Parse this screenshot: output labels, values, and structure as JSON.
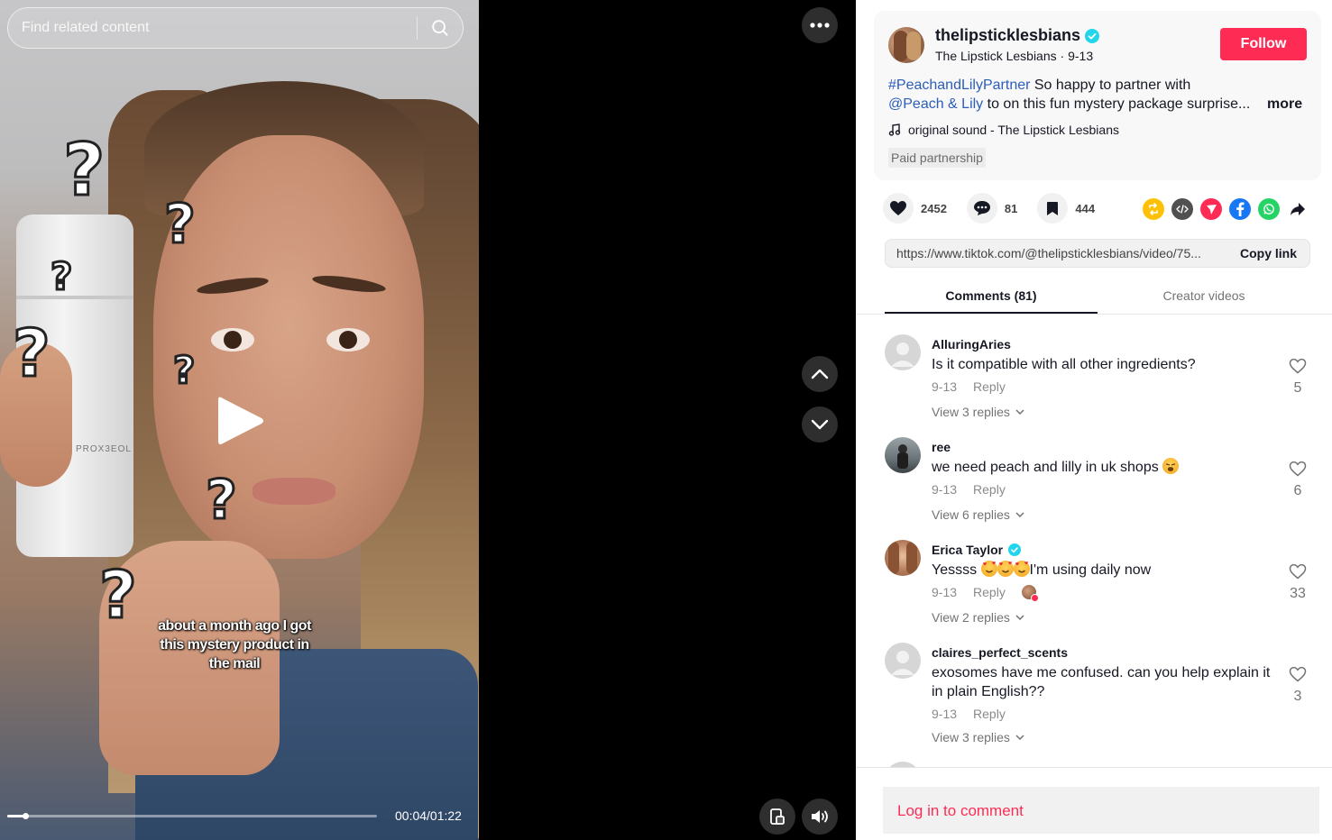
{
  "search": {
    "placeholder": "Find related content"
  },
  "video": {
    "caption_lines": [
      "about a month ago I got",
      "this mystery product in",
      "the mail"
    ],
    "product_label": "PROX3EOL",
    "time": "00:04/01:22",
    "progress": 0.049
  },
  "post": {
    "username": "thelipsticklesbians",
    "display_name": "The Lipstick Lesbians",
    "date": "9-13",
    "follow_label": "Follow",
    "hashtag": "#PeachandLilyPartner",
    "desc_text_1": " So happy to partner with",
    "mention": "@Peach & Lily",
    "desc_text_2": " to on this fun mystery package surprise...",
    "more_label": "more",
    "sound": "original sound - The Lipstick Lesbians",
    "paid_label": "Paid partnership"
  },
  "stats": {
    "likes": "2452",
    "comments": "81",
    "saves": "444"
  },
  "share": {
    "link": "https://www.tiktok.com/@thelipsticklesbians/video/75...",
    "copy_label": "Copy link"
  },
  "tabs": {
    "comments": "Comments (81)",
    "creator": "Creator videos"
  },
  "comments": [
    {
      "name": "AlluringAries",
      "text": "Is it compatible with all other ingredients?",
      "date": "9-13",
      "reply": "Reply",
      "view": "View 3 replies",
      "likes": "5"
    },
    {
      "name": "ree",
      "text": "we need peach and lilly in uk shops",
      "date": "9-13",
      "reply": "Reply",
      "view": "View 6 replies",
      "likes": "6"
    },
    {
      "name": "Erica Taylor",
      "text": "I'm using daily now",
      "text_prefix": "Yessss ",
      "date": "9-13",
      "reply": "Reply",
      "view": "View 2 replies",
      "likes": "33"
    },
    {
      "name": "claires_perfect_scents",
      "text": "exosomes have me confused. can you help explain it in plain English??",
      "date": "9-13",
      "reply": "Reply",
      "view": "View 3 replies",
      "likes": "3"
    }
  ],
  "login": {
    "label": "Log in to comment"
  },
  "colors": {
    "accent": "#fe2c55",
    "link": "#2b5db9",
    "verified": "#20d5ec"
  }
}
